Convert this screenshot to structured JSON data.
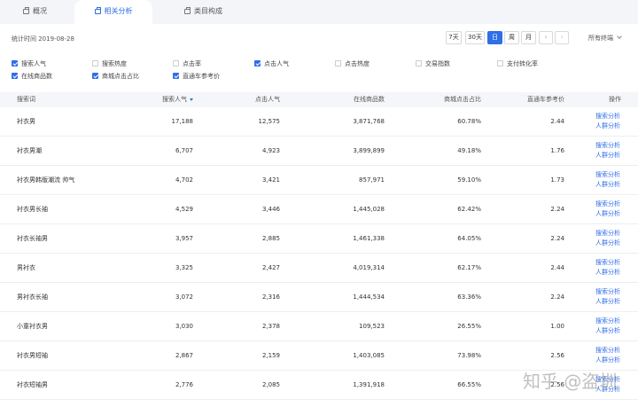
{
  "tabs": [
    {
      "label": "概况"
    },
    {
      "label": "相关分析"
    },
    {
      "label": "类目构成"
    }
  ],
  "stat": {
    "label": "统计时间 2019-08-28"
  },
  "controls": {
    "d7": "7天",
    "d30": "30天",
    "day": "日",
    "week": "周",
    "month": "月",
    "prev": "‹",
    "next": "›",
    "terminal": "所有终端"
  },
  "metrics": [
    {
      "label": "搜索人气",
      "checked": true
    },
    {
      "label": "搜索热度",
      "checked": false
    },
    {
      "label": "点击率",
      "checked": false
    },
    {
      "label": "点击人气",
      "checked": true
    },
    {
      "label": "点击热度",
      "checked": false
    },
    {
      "label": "交易指数",
      "checked": false
    },
    {
      "label": "支付转化率",
      "checked": false
    },
    {
      "label": "在线商品数",
      "checked": true
    },
    {
      "label": "商城点击占比",
      "checked": true
    },
    {
      "label": "直通车参考价",
      "checked": true
    }
  ],
  "table": {
    "headers": [
      "搜索词",
      "搜索人气",
      "点击人气",
      "在线商品数",
      "商城点击占比",
      "直通车参考价",
      "操作"
    ],
    "op_search": "搜索分析",
    "op_crowd": "人群分析",
    "rows": [
      [
        "衬衣男",
        "17,188",
        "12,575",
        "3,871,768",
        "60.78%",
        "2.44"
      ],
      [
        "衬衣男潮",
        "6,707",
        "4,923",
        "3,899,899",
        "49.18%",
        "1.76"
      ],
      [
        "衬衣男韩版潮流 帅气",
        "4,702",
        "3,421",
        "857,971",
        "59.10%",
        "1.73"
      ],
      [
        "衬衣男长袖",
        "4,529",
        "3,446",
        "1,445,028",
        "62.42%",
        "2.24"
      ],
      [
        "衬衣长袖男",
        "3,957",
        "2,885",
        "1,461,338",
        "64.05%",
        "2.24"
      ],
      [
        "男衬衣",
        "3,325",
        "2,427",
        "4,019,314",
        "62.17%",
        "2.44"
      ],
      [
        "男衬衣长袖",
        "3,072",
        "2,316",
        "1,444,534",
        "63.36%",
        "2.24"
      ],
      [
        "小童衬衣男",
        "3,030",
        "2,378",
        "109,523",
        "26.55%",
        "1.00"
      ],
      [
        "衬衣男短袖",
        "2,867",
        "2,159",
        "1,403,085",
        "73.98%",
        "2.56"
      ],
      [
        "衬衣短袖男",
        "2,776",
        "2,085",
        "1,391,918",
        "66.55%",
        "2.56"
      ]
    ]
  },
  "watermark": "知乎 @盗圳"
}
